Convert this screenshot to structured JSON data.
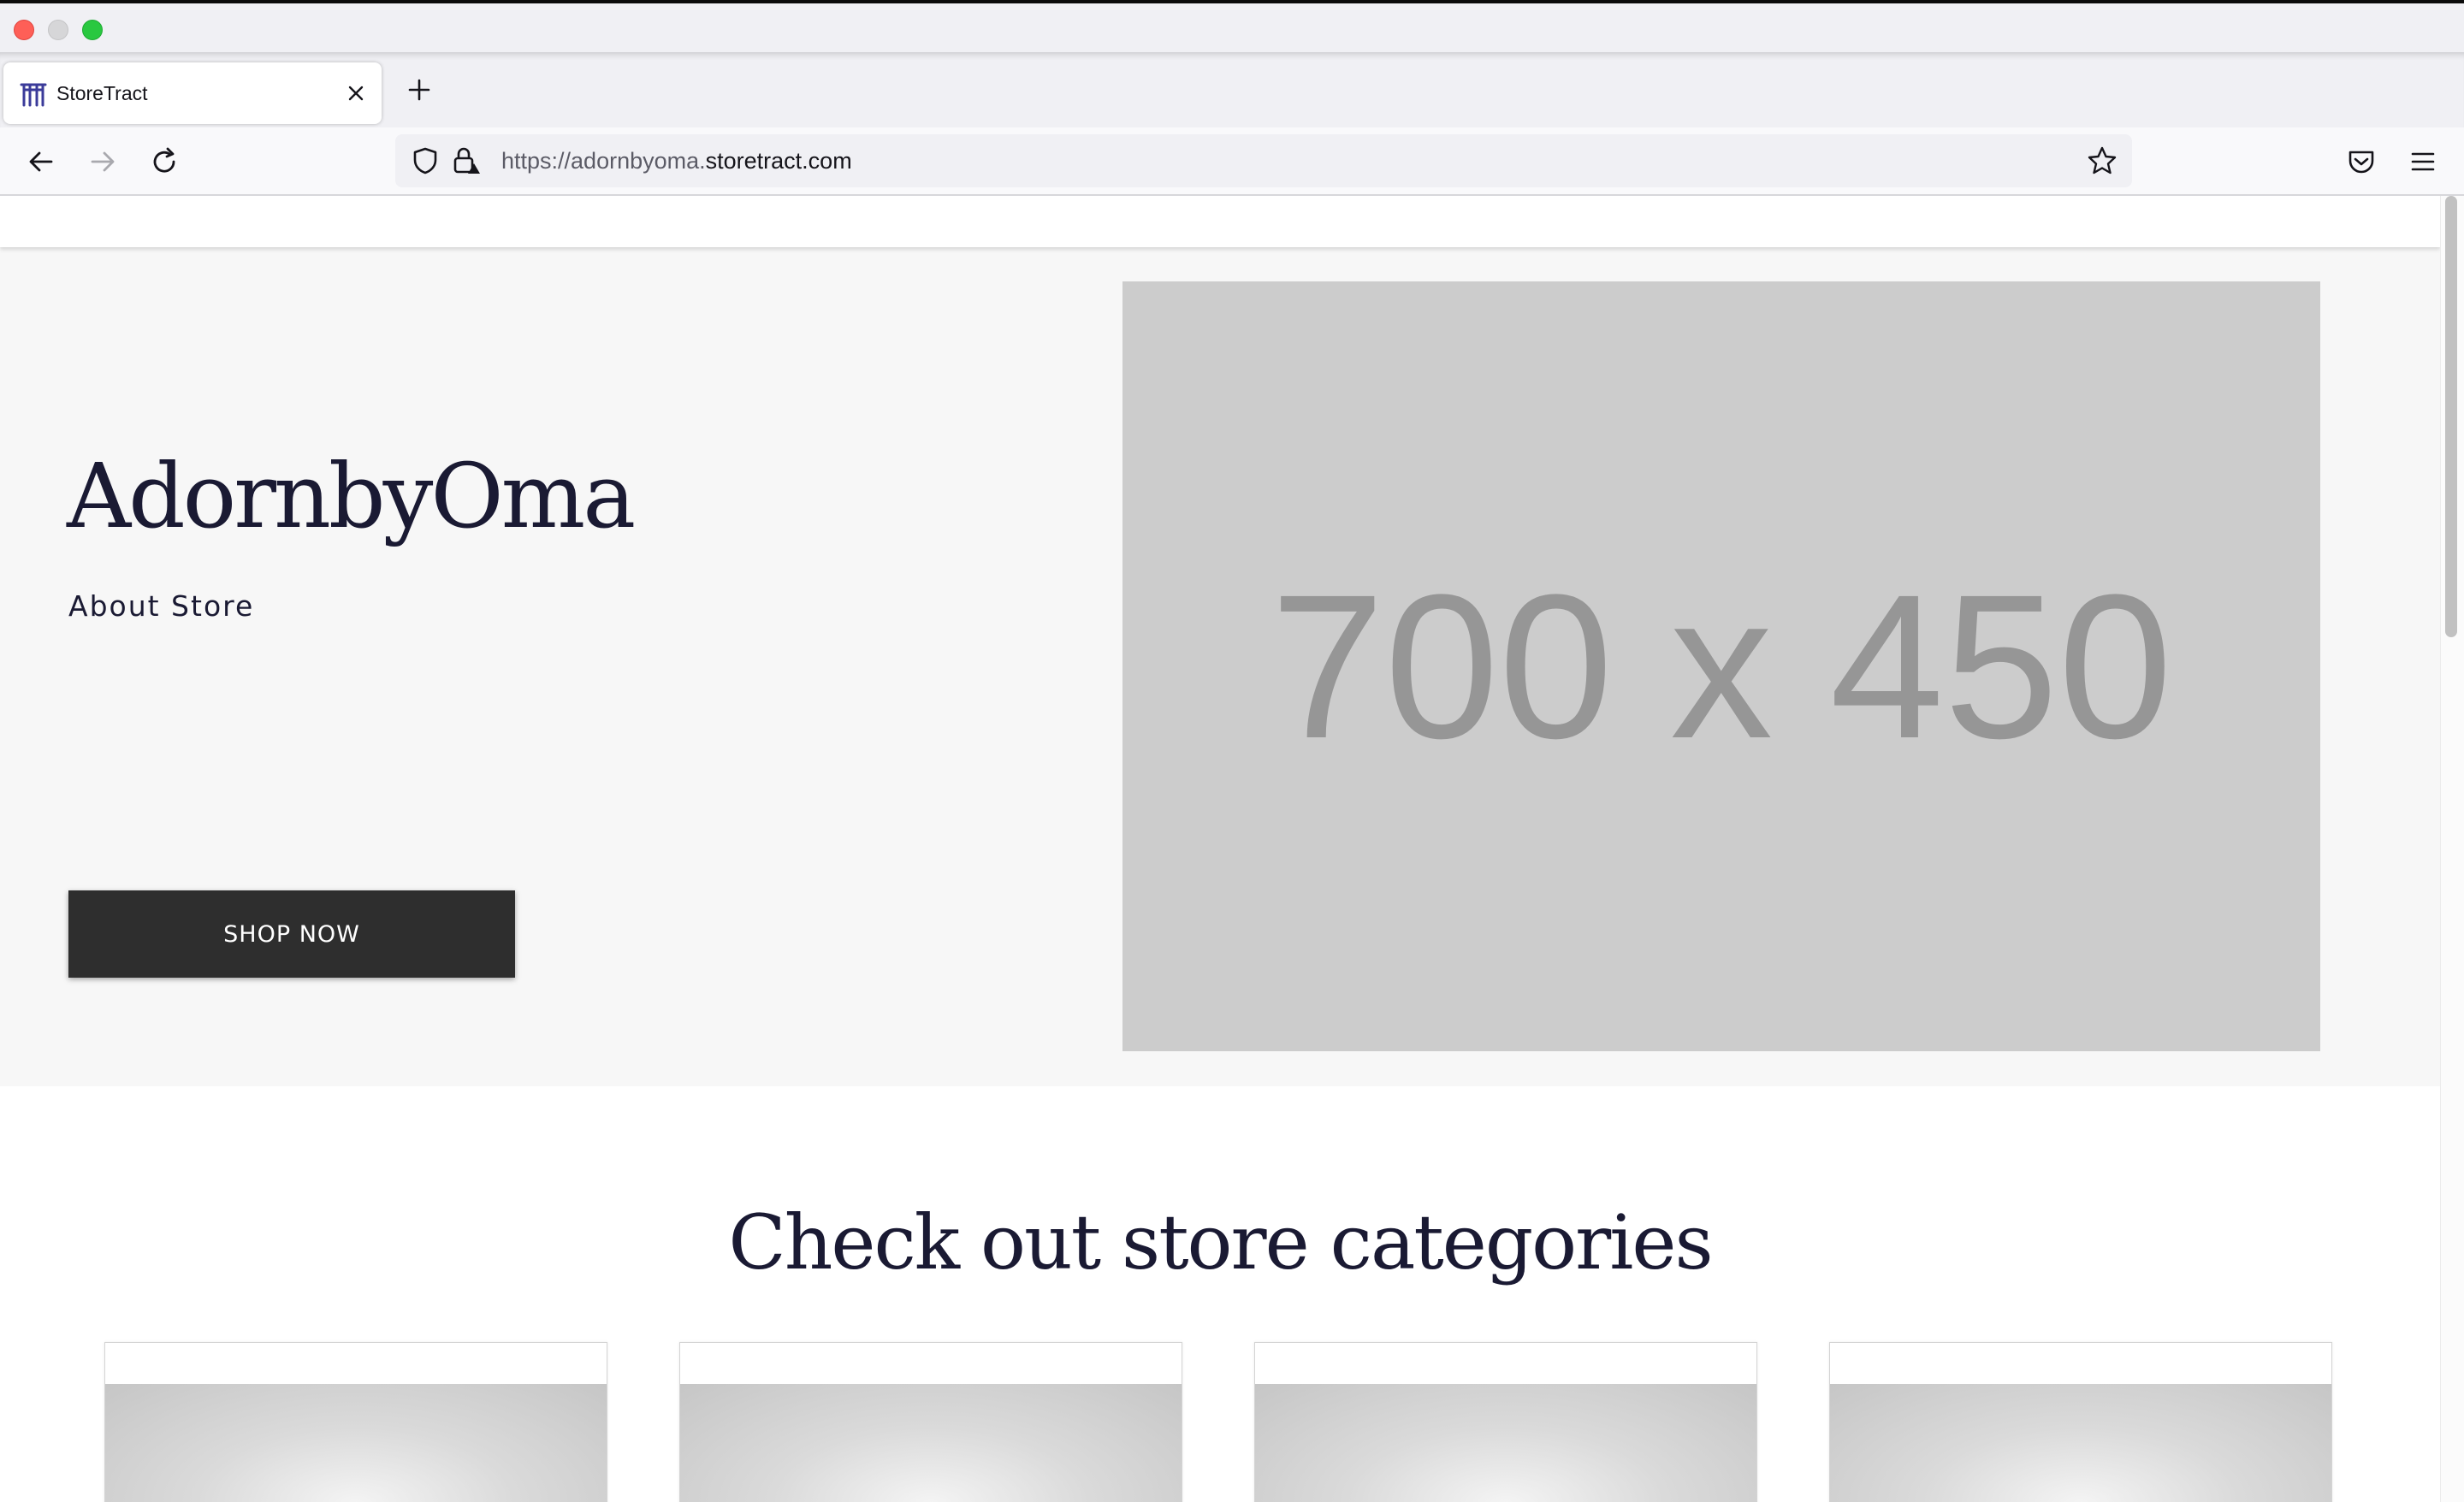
{
  "browser": {
    "tab": {
      "title": "StoreTract"
    },
    "url": {
      "prefix": "https://adornbyoma.",
      "host": "storetract.com"
    }
  },
  "hero": {
    "store_name": "AdornbyOma",
    "about_label": "About Store",
    "cta_label": "SHOP NOW",
    "placeholder_label": "700 x 450"
  },
  "categories": {
    "title": "Check out store categories",
    "cards": [
      {},
      {},
      {},
      {}
    ]
  }
}
